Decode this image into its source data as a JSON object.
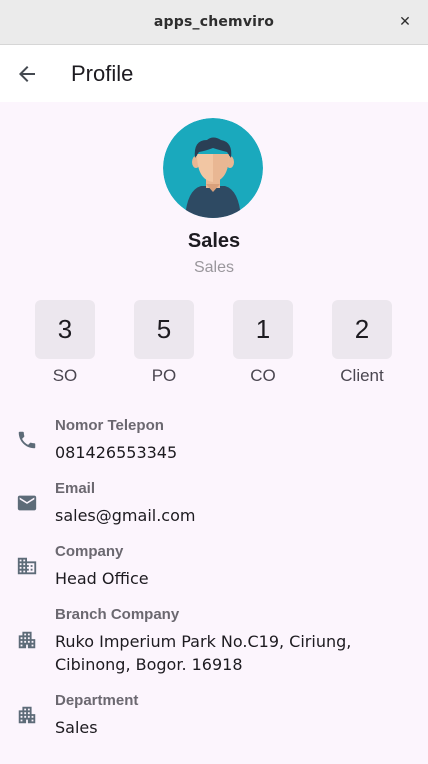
{
  "window": {
    "title": "apps_chemviro",
    "close_glyph": "✕"
  },
  "appbar": {
    "title": "Profile",
    "back_icon": "arrow-left-icon"
  },
  "profile": {
    "name": "Sales",
    "role": "Sales",
    "avatar_icon": "user-avatar-icon"
  },
  "stats": [
    {
      "value": "3",
      "label": "SO"
    },
    {
      "value": "5",
      "label": "PO"
    },
    {
      "value": "1",
      "label": "CO"
    },
    {
      "value": "2",
      "label": "Client"
    }
  ],
  "info": [
    {
      "key": "Nomor Telepon",
      "value": "081426553345",
      "icon": "phone-icon"
    },
    {
      "key": "Email",
      "value": "sales@gmail.com",
      "icon": "email-icon"
    },
    {
      "key": "Company",
      "value": "Head Office",
      "icon": "business-icon"
    },
    {
      "key": "Branch Company",
      "value": "Ruko Imperium Park No.C19, Ciriung, Cibinong, Bogor. 16918",
      "icon": "apartment-icon"
    },
    {
      "key": "Department",
      "value": "Sales",
      "icon": "apartment-icon"
    }
  ],
  "colors": {
    "background": "#fcf5fd",
    "appbar": "#ffffff",
    "stat_box": "#ece7ee",
    "icon": "#5d6b78",
    "avatar_bg": "#1aa9bd"
  }
}
